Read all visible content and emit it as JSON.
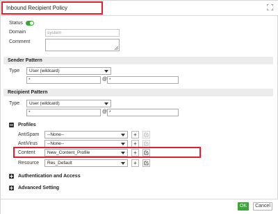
{
  "dialog": {
    "title": "Inbound Recipient Policy"
  },
  "status": {
    "label": "Status",
    "enabled": true
  },
  "domain": {
    "label": "Domain",
    "value": "system"
  },
  "comment": {
    "label": "Comment",
    "value": ""
  },
  "sender_pattern": {
    "heading": "Sender Pattern",
    "type_label": "Type",
    "type_value": "User (wildcard)",
    "user_value": "*",
    "at": "@",
    "domain_value": "*"
  },
  "recipient_pattern": {
    "heading": "Recipient Pattern",
    "type_label": "Type",
    "type_value": "User (wildcard)",
    "user_value": "*",
    "at": "@",
    "domain_value": "*"
  },
  "profiles": {
    "title": "Profiles",
    "rows": [
      {
        "label": "AntiSpam",
        "value": "--None--"
      },
      {
        "label": "AntiVirus",
        "value": "--None--"
      },
      {
        "label": "Content",
        "value": "New_Content_Profile"
      },
      {
        "label": "Resource",
        "value": "Res_Default"
      }
    ],
    "add_symbol": "+"
  },
  "auth_access": {
    "title": "Authentication and Access"
  },
  "advanced": {
    "title": "Advanced Setting"
  },
  "footer": {
    "ok_label": "OK",
    "cancel_label": "Cancel"
  },
  "colors": {
    "accent_green": "#3aa63a",
    "highlight_red": "#e0202e"
  }
}
